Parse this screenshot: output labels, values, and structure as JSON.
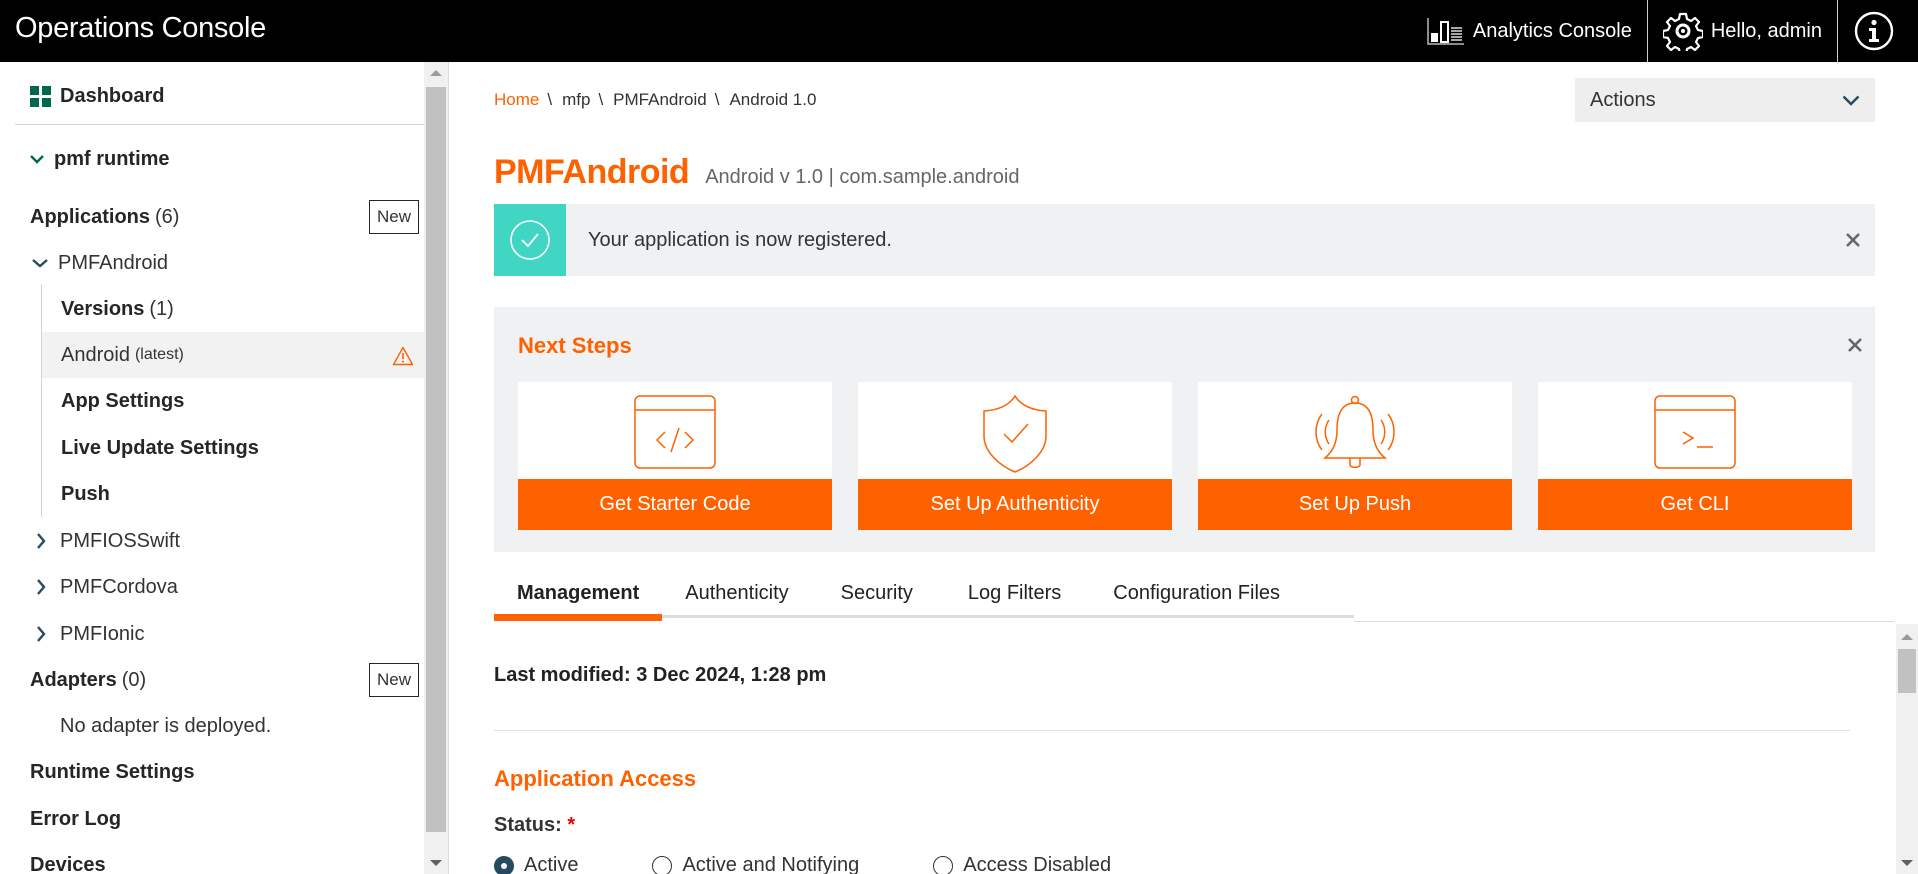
{
  "header": {
    "app_title": "Operations Console",
    "analytics_label": "Analytics Console",
    "greeting": "Hello, admin",
    "icons": [
      "analytics-chart-icon",
      "gear-icon",
      "info-icon"
    ]
  },
  "sidebar": {
    "dashboard_label": "Dashboard",
    "runtime_label": "pmf runtime",
    "applications": {
      "label": "Applications",
      "count": "(6)",
      "new_label": "New",
      "apps": [
        {
          "name": "PMFAndroid",
          "expanded": true,
          "children": [
            {
              "label": "Versions",
              "count": "(1)",
              "bold": true
            },
            {
              "label": "Android",
              "suffix": "(latest)",
              "selected": true,
              "warning": true
            },
            {
              "label": "App Settings",
              "bold": true
            },
            {
              "label": "Live Update Settings",
              "bold": true
            },
            {
              "label": "Push",
              "bold": true
            }
          ]
        },
        {
          "name": "PMFIOSSwift",
          "expanded": false
        },
        {
          "name": "PMFCordova",
          "expanded": false
        },
        {
          "name": "PMFIonic",
          "expanded": false
        }
      ]
    },
    "adapters": {
      "label": "Adapters",
      "count": "(0)",
      "new_label": "New",
      "empty_text": "No adapter is deployed."
    },
    "runtime_settings_label": "Runtime Settings",
    "error_log_label": "Error Log",
    "devices_label": "Devices"
  },
  "breadcrumb": [
    {
      "label": "Home",
      "link": true
    },
    {
      "label": "mfp"
    },
    {
      "label": "PMFAndroid"
    },
    {
      "label": "Android 1.0"
    }
  ],
  "breadcrumb_separator": "\\",
  "actions_label": "Actions",
  "page": {
    "title": "PMFAndroid",
    "subtitle": "Android v 1.0 | com.sample.android"
  },
  "alert": {
    "message": "Your application is now registered.",
    "color": "#41d6c3"
  },
  "next_steps": {
    "title": "Next Steps",
    "cards": [
      {
        "label": "Get Starter Code",
        "icon": "code-window-icon"
      },
      {
        "label": "Set Up Authenticity",
        "icon": "shield-check-icon"
      },
      {
        "label": "Set Up Push",
        "icon": "bell-ringing-icon"
      },
      {
        "label": "Get CLI",
        "icon": "terminal-window-icon"
      }
    ]
  },
  "tabs": [
    {
      "label": "Management",
      "active": true
    },
    {
      "label": "Authenticity"
    },
    {
      "label": "Security"
    },
    {
      "label": "Log Filters"
    },
    {
      "label": "Configuration Files"
    }
  ],
  "last_modified": "Last modified: 3 Dec 2024, 1:28 pm",
  "application_access": {
    "title": "Application Access",
    "status_label": "Status:",
    "required_mark": "*",
    "options": [
      {
        "label": "Active",
        "selected": true
      },
      {
        "label": "Active and Notifying",
        "selected": false
      },
      {
        "label": "Access Disabled",
        "selected": false
      }
    ]
  },
  "colors": {
    "brand_orange": "#fe6100",
    "dashboard_green": "#00684f",
    "success_teal": "#41d6c3",
    "nav_chevron": "#264a60"
  }
}
